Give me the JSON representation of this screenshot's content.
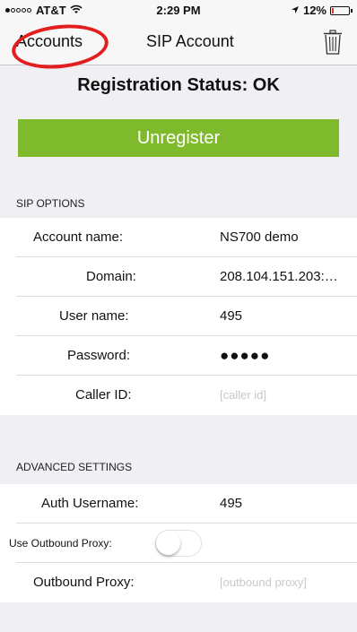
{
  "status_bar": {
    "carrier": "AT&T",
    "time": "2:29 PM",
    "battery": "12%",
    "battery_level": 0.12
  },
  "nav": {
    "back_label": "Accounts",
    "title": "SIP Account",
    "trash_icon": "trash-icon",
    "highlight_color": "#e21e1e"
  },
  "registration": {
    "status": "Registration Status: OK"
  },
  "unregister": {
    "label": "Unregister",
    "color": "#7fba2c"
  },
  "sip_options": {
    "header": "SIP OPTIONS",
    "rows": [
      {
        "label": "Account name:",
        "value": "NS700 demo"
      },
      {
        "label": "Domain:",
        "value": "208.104.151.203:…"
      },
      {
        "label": "User name:",
        "value": "495"
      },
      {
        "label": "Password:",
        "value": "●●●●●"
      },
      {
        "label": "Caller ID:",
        "placeholder": "[caller id]"
      }
    ]
  },
  "advanced": {
    "header": "ADVANCED SETTINGS",
    "auth_username": {
      "label": "Auth Username:",
      "value": "495"
    },
    "outbound_proxy_toggle": {
      "label": "Use Outbound Proxy:",
      "on": false
    },
    "outbound_proxy": {
      "label": "Outbound Proxy:",
      "placeholder": "[outbound proxy]"
    }
  }
}
